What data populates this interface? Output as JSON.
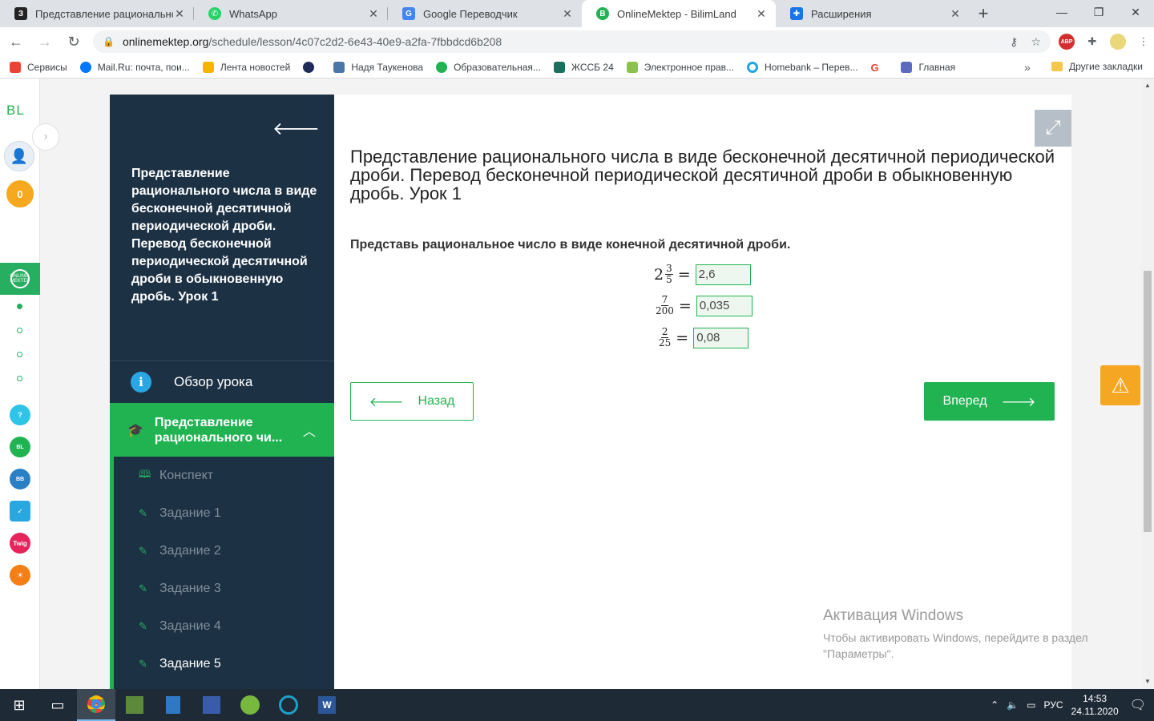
{
  "browser": {
    "tabs": [
      {
        "label": "Представление рациональног",
        "icon": "document-icon",
        "color": "#222222",
        "glyph": "З"
      },
      {
        "label": "WhatsApp",
        "icon": "whatsapp-icon",
        "color": "#25d366",
        "glyph": ""
      },
      {
        "label": "Google Переводчик",
        "icon": "translate-icon",
        "color": "#4285f4",
        "glyph": ""
      },
      {
        "label": "OnlineMektep - BilimLand",
        "icon": "bilimland-icon",
        "color": "#21b352",
        "glyph": "B"
      },
      {
        "label": "Расширения",
        "icon": "puzzle-icon",
        "color": "#1a73e8",
        "glyph": ""
      }
    ],
    "url_host": "onlinemektep.org",
    "url_path": "/schedule/lesson/4c07c2d2-6e43-40e9-a2fa-7fbbdcd6b208",
    "new_tab": "+",
    "abp_label": "ABP",
    "bookmarks": [
      {
        "label": "Сервисы",
        "color": "#ea4335"
      },
      {
        "label": "Mail.Ru: почта, пои...",
        "color": "#0077ff"
      },
      {
        "label": "Лента новостей",
        "color": "#f4b400"
      },
      {
        "label": "",
        "color": "#1f2a5a"
      },
      {
        "label": "Надя Таукенова",
        "color": "#4a76a8"
      },
      {
        "label": "Образовательная...",
        "color": "#21b352"
      },
      {
        "label": "ЖССБ 24",
        "color": "#1b6f5c"
      },
      {
        "label": "Электронное прав...",
        "color": "#8bc34a"
      },
      {
        "label": "Homebank – Перев...",
        "color": "#1ea7e1"
      },
      {
        "label": "",
        "color": "#ea4335"
      },
      {
        "label": "Главная",
        "color": "#5c6bc0"
      }
    ],
    "bookmarks_more": "»",
    "other_bookmarks": "Другие закладки"
  },
  "rail": {
    "logo": "BL",
    "score": "0",
    "active_label": "ONLINE MEKTEP",
    "apps": [
      {
        "label": "?",
        "color": "#2ec4e8",
        "icon": "help-icon"
      },
      {
        "label": "BL",
        "color": "#21b352",
        "icon": "bilimland-app-icon"
      },
      {
        "label": "BB",
        "color": "#2b7fc4",
        "icon": "bilimbook-icon"
      },
      {
        "label": "✓",
        "color": "#29a8e0",
        "icon": "test-app-icon"
      },
      {
        "label": "Twig",
        "color": "#e4245b",
        "icon": "twig-icon"
      },
      {
        "label": "☀",
        "color": "#f57f17",
        "icon": "imektep-icon"
      }
    ]
  },
  "sidebar": {
    "title": "Представление рационального числа в виде бесконечной десятичной периодической дроби. Перевод бесконечной периодической десятичной дроби в обыкновенную дробь. Урок 1",
    "overview": "Обзор урока",
    "group_title": "Представление рационального чи...",
    "items": [
      {
        "label": "Конспект",
        "icon": "book-icon"
      },
      {
        "label": "Задание 1",
        "icon": "edit-icon"
      },
      {
        "label": "Задание 2",
        "icon": "edit-icon"
      },
      {
        "label": "Задание 3",
        "icon": "edit-icon"
      },
      {
        "label": "Задание 4",
        "icon": "edit-icon"
      },
      {
        "label": "Задание 5",
        "icon": "edit-icon"
      }
    ]
  },
  "main": {
    "lesson_title": "Представление рационального числа в виде бесконечной десятичной периодической дроби. Перевод бесконечной периодической десятичной дроби в обыкновенную дробь. Урок 1",
    "task": "Представь рациональное число в виде конечной десятичной дроби.",
    "equations": [
      {
        "whole": "2",
        "num": "3",
        "den": "5",
        "eq": "=",
        "answer": "2,6"
      },
      {
        "whole": "",
        "num": "7",
        "den": "200",
        "eq": "=",
        "answer": "0,035"
      },
      {
        "whole": "",
        "num": "2",
        "den": "25",
        "eq": "=",
        "answer": "0,08"
      }
    ],
    "back_label": "Назад",
    "next_label": "Вперед"
  },
  "activation": {
    "title": "Активация Windows",
    "text": "Чтобы активировать Windows, перейдите в раздел \"Параметры\"."
  },
  "taskbar": {
    "lang": "РУС",
    "time": "14:53",
    "date": "24.11.2020"
  }
}
